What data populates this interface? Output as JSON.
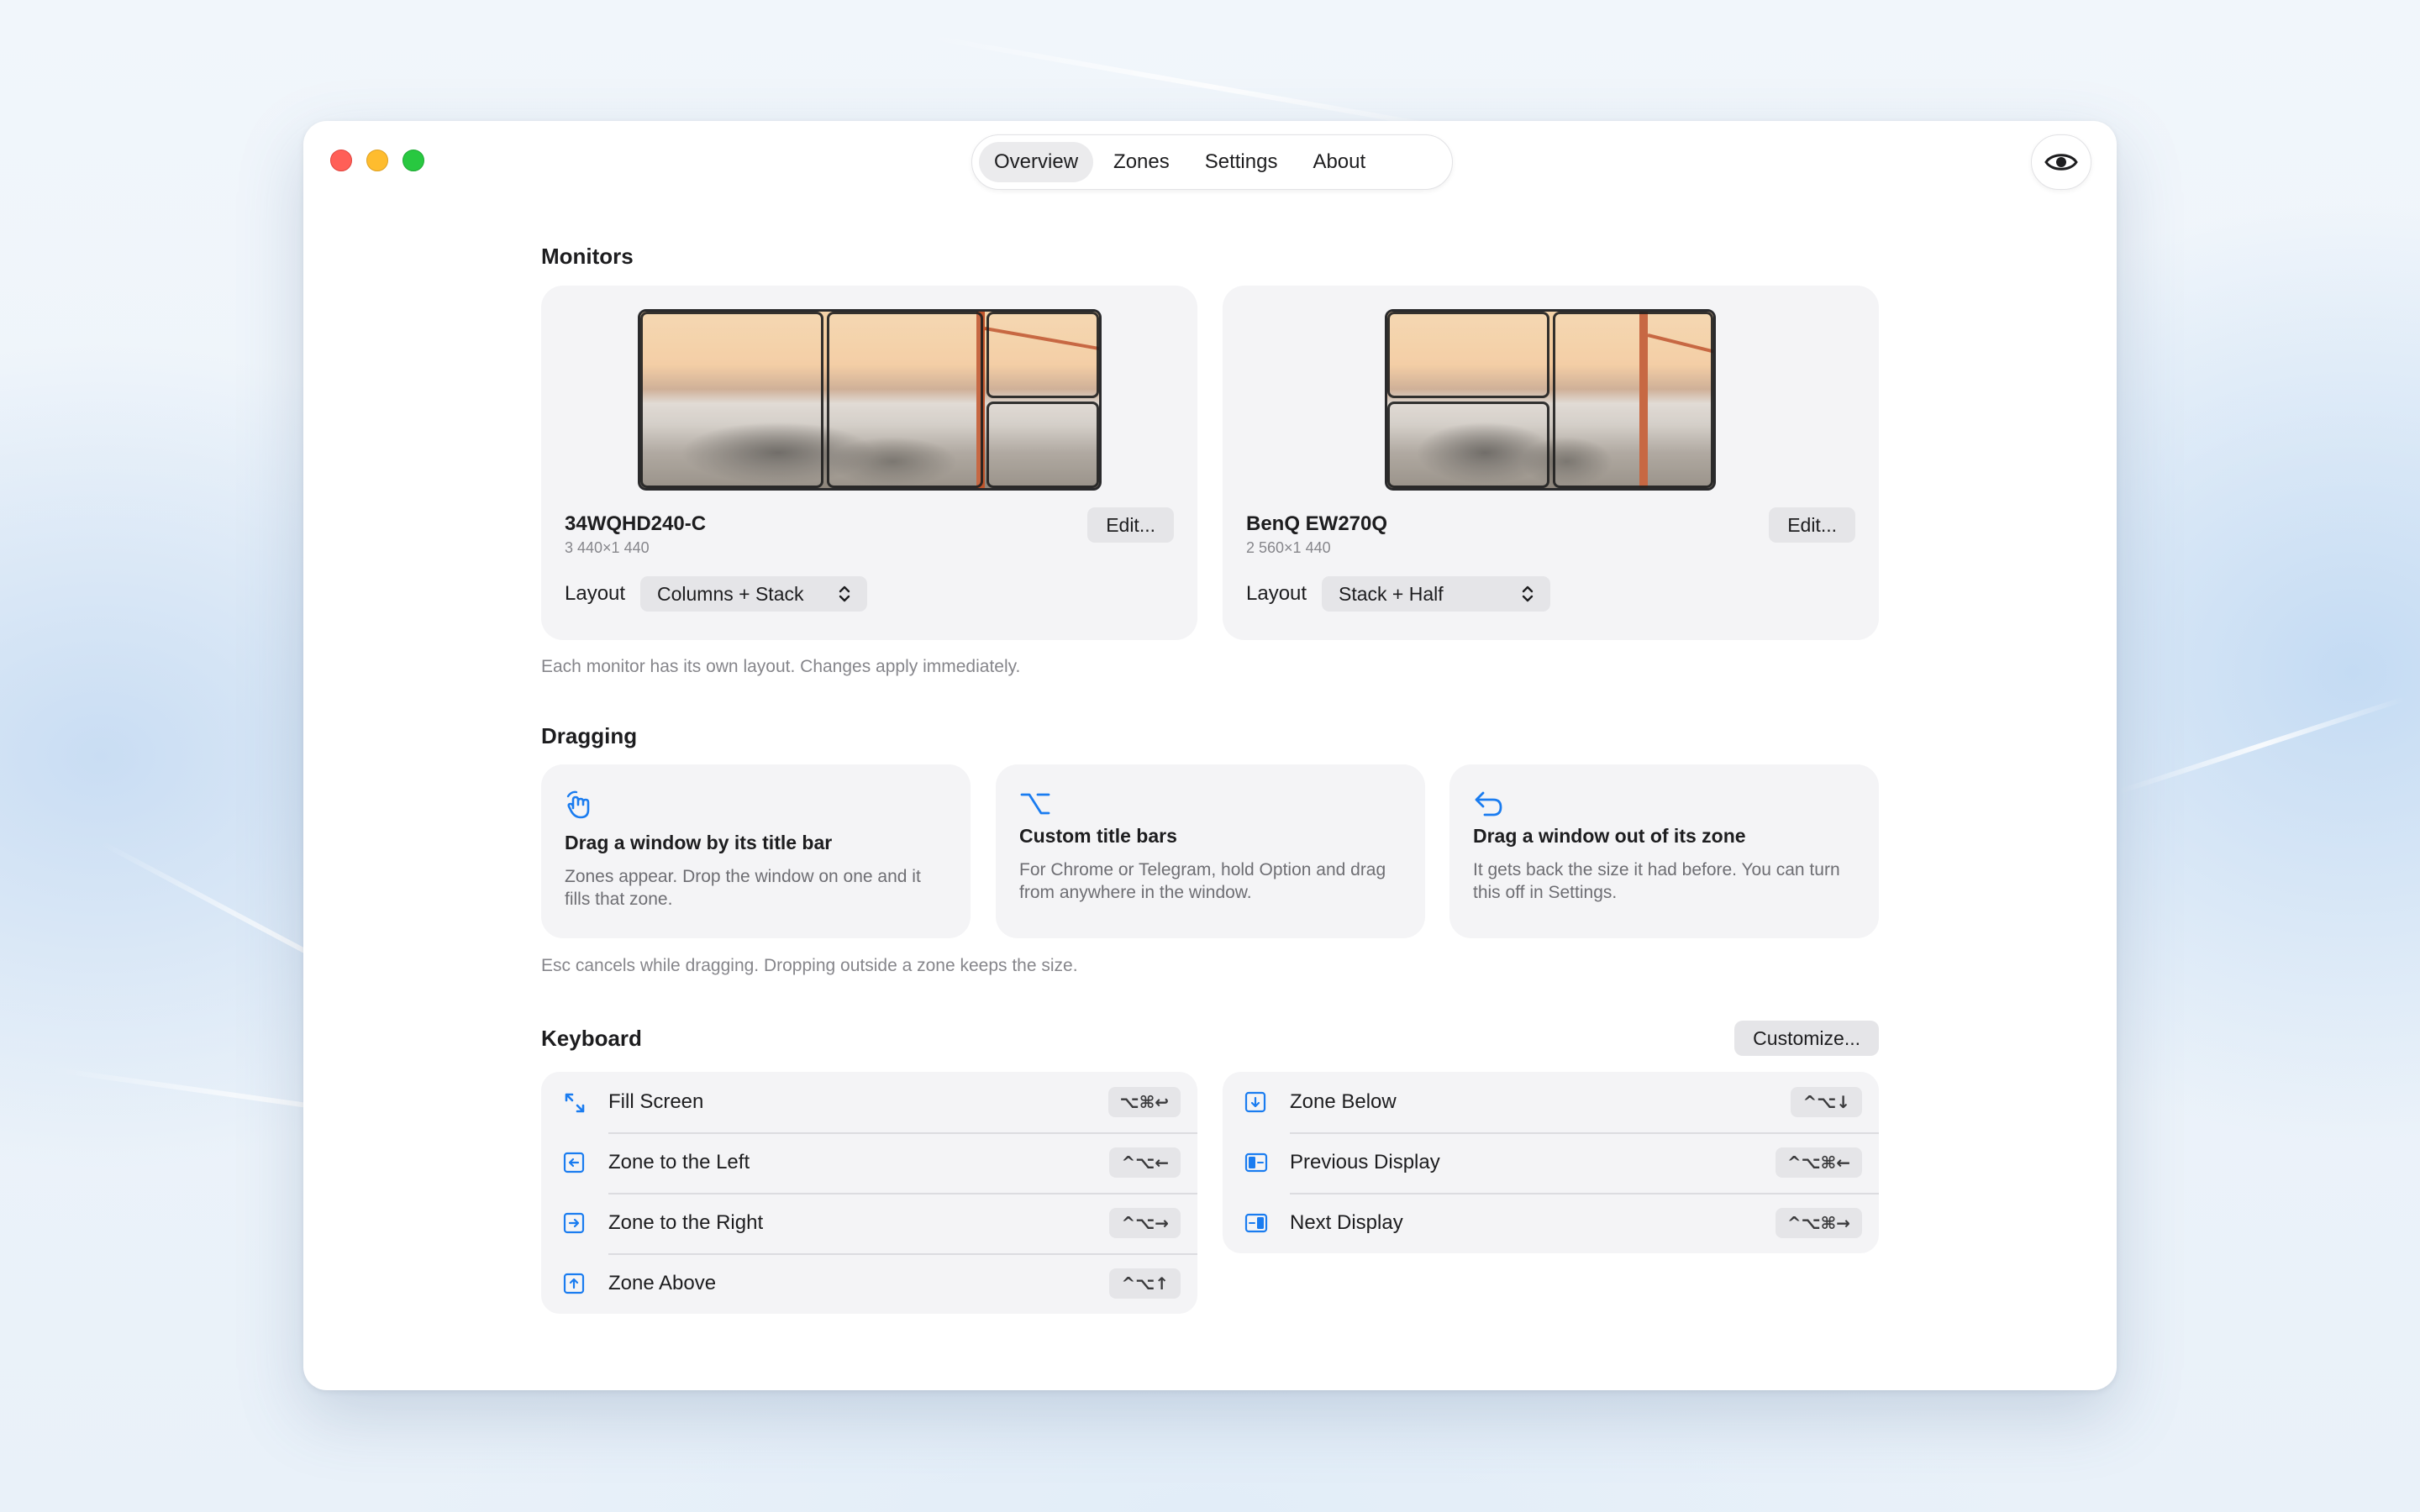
{
  "tabs": [
    {
      "label": "Overview",
      "active": true
    },
    {
      "label": "Zones",
      "active": false
    },
    {
      "label": "Settings",
      "active": false
    },
    {
      "label": "About",
      "active": false
    }
  ],
  "monitors": {
    "title": "Monitors",
    "caption": "Each monitor has its own layout. Changes apply immediately.",
    "items": [
      {
        "name": "34WQHD240-C",
        "resolution": "3 440×1 440",
        "edit_label": "Edit...",
        "layout_label": "Layout",
        "layout_value": "Columns + Stack"
      },
      {
        "name": "BenQ EW270Q",
        "resolution": "2 560×1 440",
        "edit_label": "Edit...",
        "layout_label": "Layout",
        "layout_value": "Stack + Half"
      }
    ]
  },
  "dragging": {
    "title": "Dragging",
    "caption": "Esc cancels while dragging. Dropping outside a zone keeps the size.",
    "cards": [
      {
        "icon": "hand-drag-icon",
        "title": "Drag a window by its title bar",
        "desc": "Zones appear. Drop the window on one and it fills that zone."
      },
      {
        "icon": "option-key-icon",
        "title": "Custom title bars",
        "desc": "For Chrome or Telegram, hold Option and drag from anywhere in the window."
      },
      {
        "icon": "undo-arrow-icon",
        "title": "Drag a window out of its zone",
        "desc": "It gets back the size it had before. You can turn this off in Settings."
      }
    ]
  },
  "keyboard": {
    "title": "Keyboard",
    "customize_label": "Customize...",
    "left": [
      {
        "icon": "fill-screen-icon",
        "label": "Fill Screen",
        "shortcut": "⌥⌘↩"
      },
      {
        "icon": "zone-left-icon",
        "label": "Zone to the Left",
        "shortcut": "^⌥←"
      },
      {
        "icon": "zone-right-icon",
        "label": "Zone to the Right",
        "shortcut": "^⌥→"
      },
      {
        "icon": "zone-above-icon",
        "label": "Zone Above",
        "shortcut": "^⌥↑"
      }
    ],
    "right": [
      {
        "icon": "zone-below-icon",
        "label": "Zone Below",
        "shortcut": "^⌥↓"
      },
      {
        "icon": "previous-display-icon",
        "label": "Previous Display",
        "shortcut": "^⌥⌘←"
      },
      {
        "icon": "next-display-icon",
        "label": "Next Display",
        "shortcut": "^⌥⌘→"
      }
    ]
  },
  "colors": {
    "accent": "#1a7cf0",
    "card": "#f4f4f6"
  }
}
